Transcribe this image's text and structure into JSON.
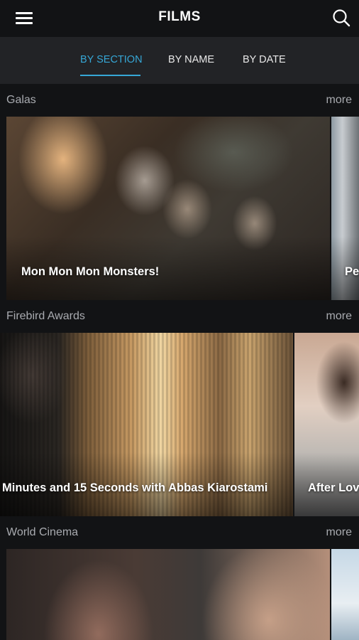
{
  "header": {
    "title": "FILMS",
    "menu_icon": "hamburger-menu-icon",
    "search_icon": "search-icon"
  },
  "tabs": [
    {
      "label": "BY SECTION",
      "active": true
    },
    {
      "label": "BY NAME",
      "active": false
    },
    {
      "label": "BY DATE",
      "active": false
    }
  ],
  "colors": {
    "accent": "#36a7d6",
    "background": "#121315",
    "tab_bar": "#222326",
    "section_text": "#a9abb0"
  },
  "sections": [
    {
      "title": "Galas",
      "more_label": "more",
      "films": [
        {
          "title": "Mon Mon Mon Monsters!"
        },
        {
          "title": "Pe"
        }
      ]
    },
    {
      "title": "Firebird Awards",
      "more_label": "more",
      "films": [
        {
          "title": "Minutes and 15 Seconds with Abbas Kiarostami"
        },
        {
          "title": "After Lov"
        }
      ]
    },
    {
      "title": "World Cinema",
      "more_label": "more",
      "films": [
        {
          "title": ""
        },
        {
          "title": ""
        }
      ]
    }
  ]
}
